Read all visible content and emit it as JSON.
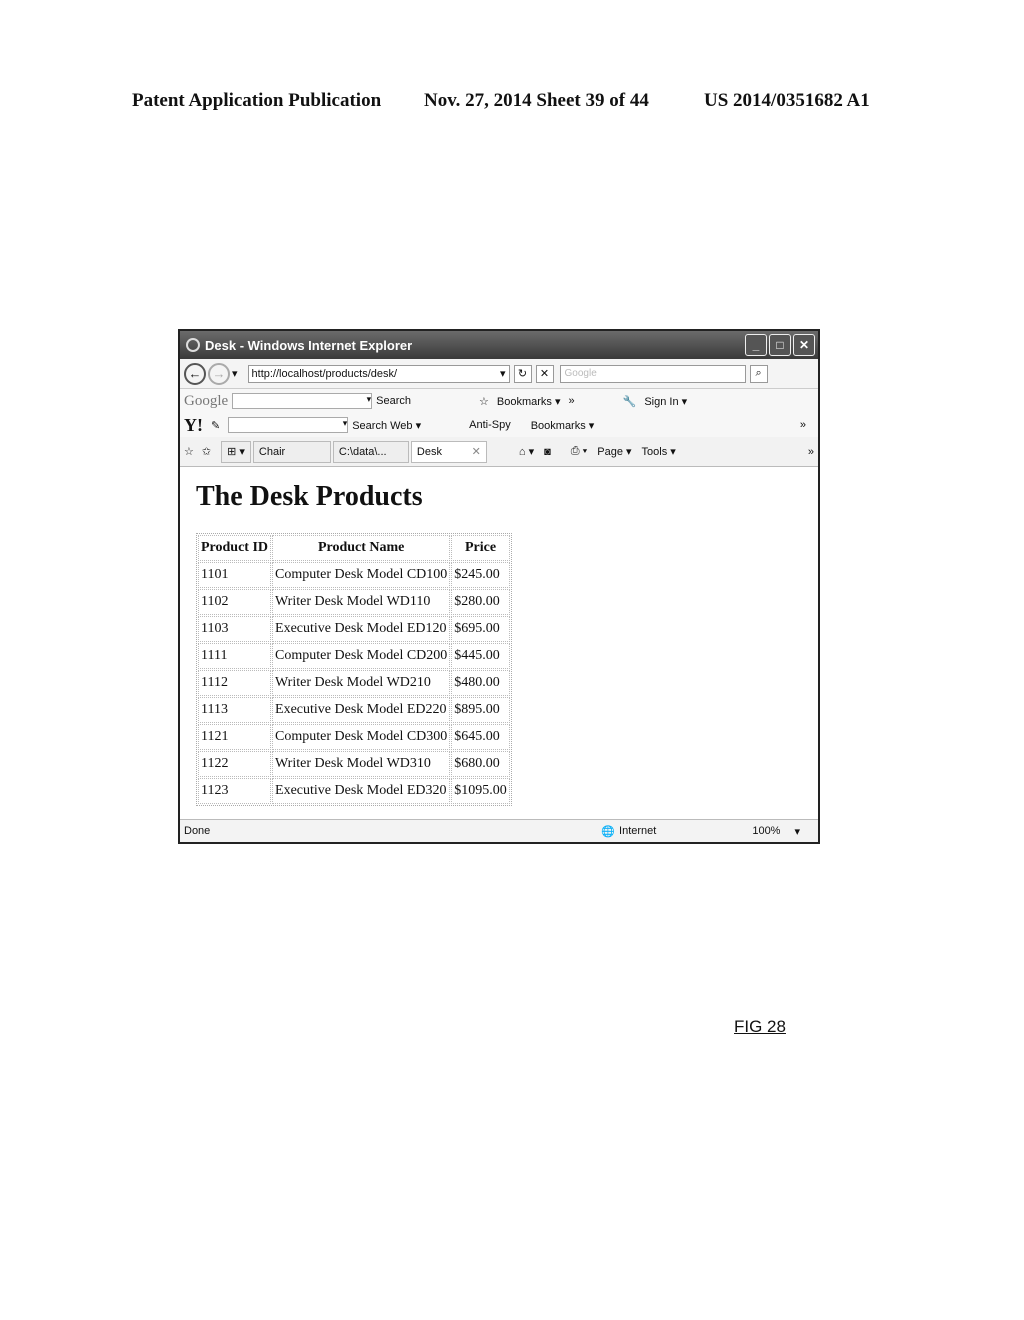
{
  "patent_header": {
    "left": "Patent Application Publication",
    "middle": "Nov. 27, 2014  Sheet 39 of 44",
    "right": "US 2014/0351682 A1"
  },
  "window": {
    "title": "Desk - Windows Internet Explorer",
    "controls": {
      "minimize": "_",
      "maximize": "□",
      "close": "✕"
    }
  },
  "address_bar": {
    "url": "http://localhost/products/desk/",
    "search_placeholder": "Google",
    "refresh": "↻",
    "stop": "✕",
    "search_btn": "⌕"
  },
  "google_toolbar": {
    "logo": "Google",
    "items": [
      "Search",
      "Bookmarks ▾",
      "»",
      "Sign In ▾"
    ]
  },
  "yahoo_toolbar": {
    "logo": "Y!",
    "items": [
      "Search Web ▾",
      "Anti-Spy",
      "Bookmarks ▾",
      "»"
    ]
  },
  "tabs": [
    {
      "label": "Chair"
    },
    {
      "label": "C:\\data\\..."
    },
    {
      "label": "Desk",
      "close": "✕"
    }
  ],
  "command_bar": {
    "page": "Page ▾",
    "tools": "Tools ▾",
    "more": "»"
  },
  "page": {
    "heading": "The Desk Products",
    "columns": [
      "Product ID",
      "Product Name",
      "Price"
    ],
    "rows": [
      [
        "1101",
        "Computer Desk Model CD100",
        "$245.00"
      ],
      [
        "1102",
        "Writer Desk Model WD110",
        "$280.00"
      ],
      [
        "1103",
        "Executive Desk Model ED120",
        "$695.00"
      ],
      [
        "1111",
        "Computer Desk Model CD200",
        "$445.00"
      ],
      [
        "1112",
        "Writer Desk Model WD210",
        "$480.00"
      ],
      [
        "1113",
        "Executive Desk Model ED220",
        "$895.00"
      ],
      [
        "1121",
        "Computer Desk Model CD300",
        "$645.00"
      ],
      [
        "1122",
        "Writer Desk Model WD310",
        "$680.00"
      ],
      [
        "1123",
        "Executive Desk Model ED320",
        "$1095.00"
      ]
    ]
  },
  "status_bar": {
    "status": "Done",
    "zone": "Internet",
    "zoom": "100%"
  },
  "figure_label": "FIG 28"
}
